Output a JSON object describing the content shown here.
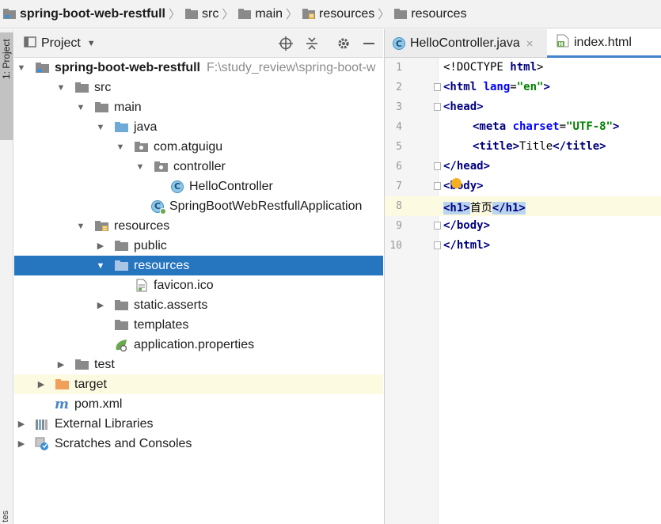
{
  "breadcrumb": [
    {
      "label": "spring-boot-web-restfull",
      "bold": true
    },
    {
      "label": "src"
    },
    {
      "label": "main"
    },
    {
      "label": "resources"
    },
    {
      "label": "resources"
    }
  ],
  "stripe": {
    "project_tab": "1: Project",
    "bottom_label": "tes"
  },
  "project_panel": {
    "title": "Project"
  },
  "tree": {
    "root": {
      "label": "spring-boot-web-restfull",
      "path": "F:\\study_review\\spring-boot-w"
    },
    "src": "src",
    "main": "main",
    "java": "java",
    "pkg": "com.atguigu",
    "controller": "controller",
    "hello": "HelloController",
    "app": "SpringBootWebRestfullApplication",
    "resources": "resources",
    "public": "public",
    "resources_sub": "resources",
    "favicon": "favicon.ico",
    "static": "static.asserts",
    "templates": "templates",
    "props": "application.properties",
    "test": "test",
    "target": "target",
    "pom": "pom.xml",
    "ext": "External Libraries",
    "scratch": "Scratches and Consoles"
  },
  "editor": {
    "tabs": [
      {
        "label": "HelloController.java",
        "close": "×"
      },
      {
        "label": "index.html"
      }
    ],
    "lines": [
      "1",
      "2",
      "3",
      "4",
      "5",
      "6",
      "7",
      "8",
      "9",
      "10"
    ],
    "code": {
      "l1_a": "<!DOCTYPE ",
      "l1_b": "html",
      "l1_c": ">",
      "l2_a": "<html ",
      "l2_b": "lang",
      "l2_c": "=",
      "l2_d": "\"en\"",
      "l2_e": ">",
      "l3": "<head>",
      "l4_a": "<meta ",
      "l4_b": "charset",
      "l4_c": "=",
      "l4_d": "\"UTF-8\"",
      "l4_e": ">",
      "l5_a": "<title>",
      "l5_b": "Title",
      "l5_c": "</title>",
      "l6": "</head>",
      "l7": "<body>",
      "l8_a": "<h1>",
      "l8_b": "首页",
      "l8_c": "</h1>",
      "l9": "</body>",
      "l10": "</html>"
    }
  }
}
